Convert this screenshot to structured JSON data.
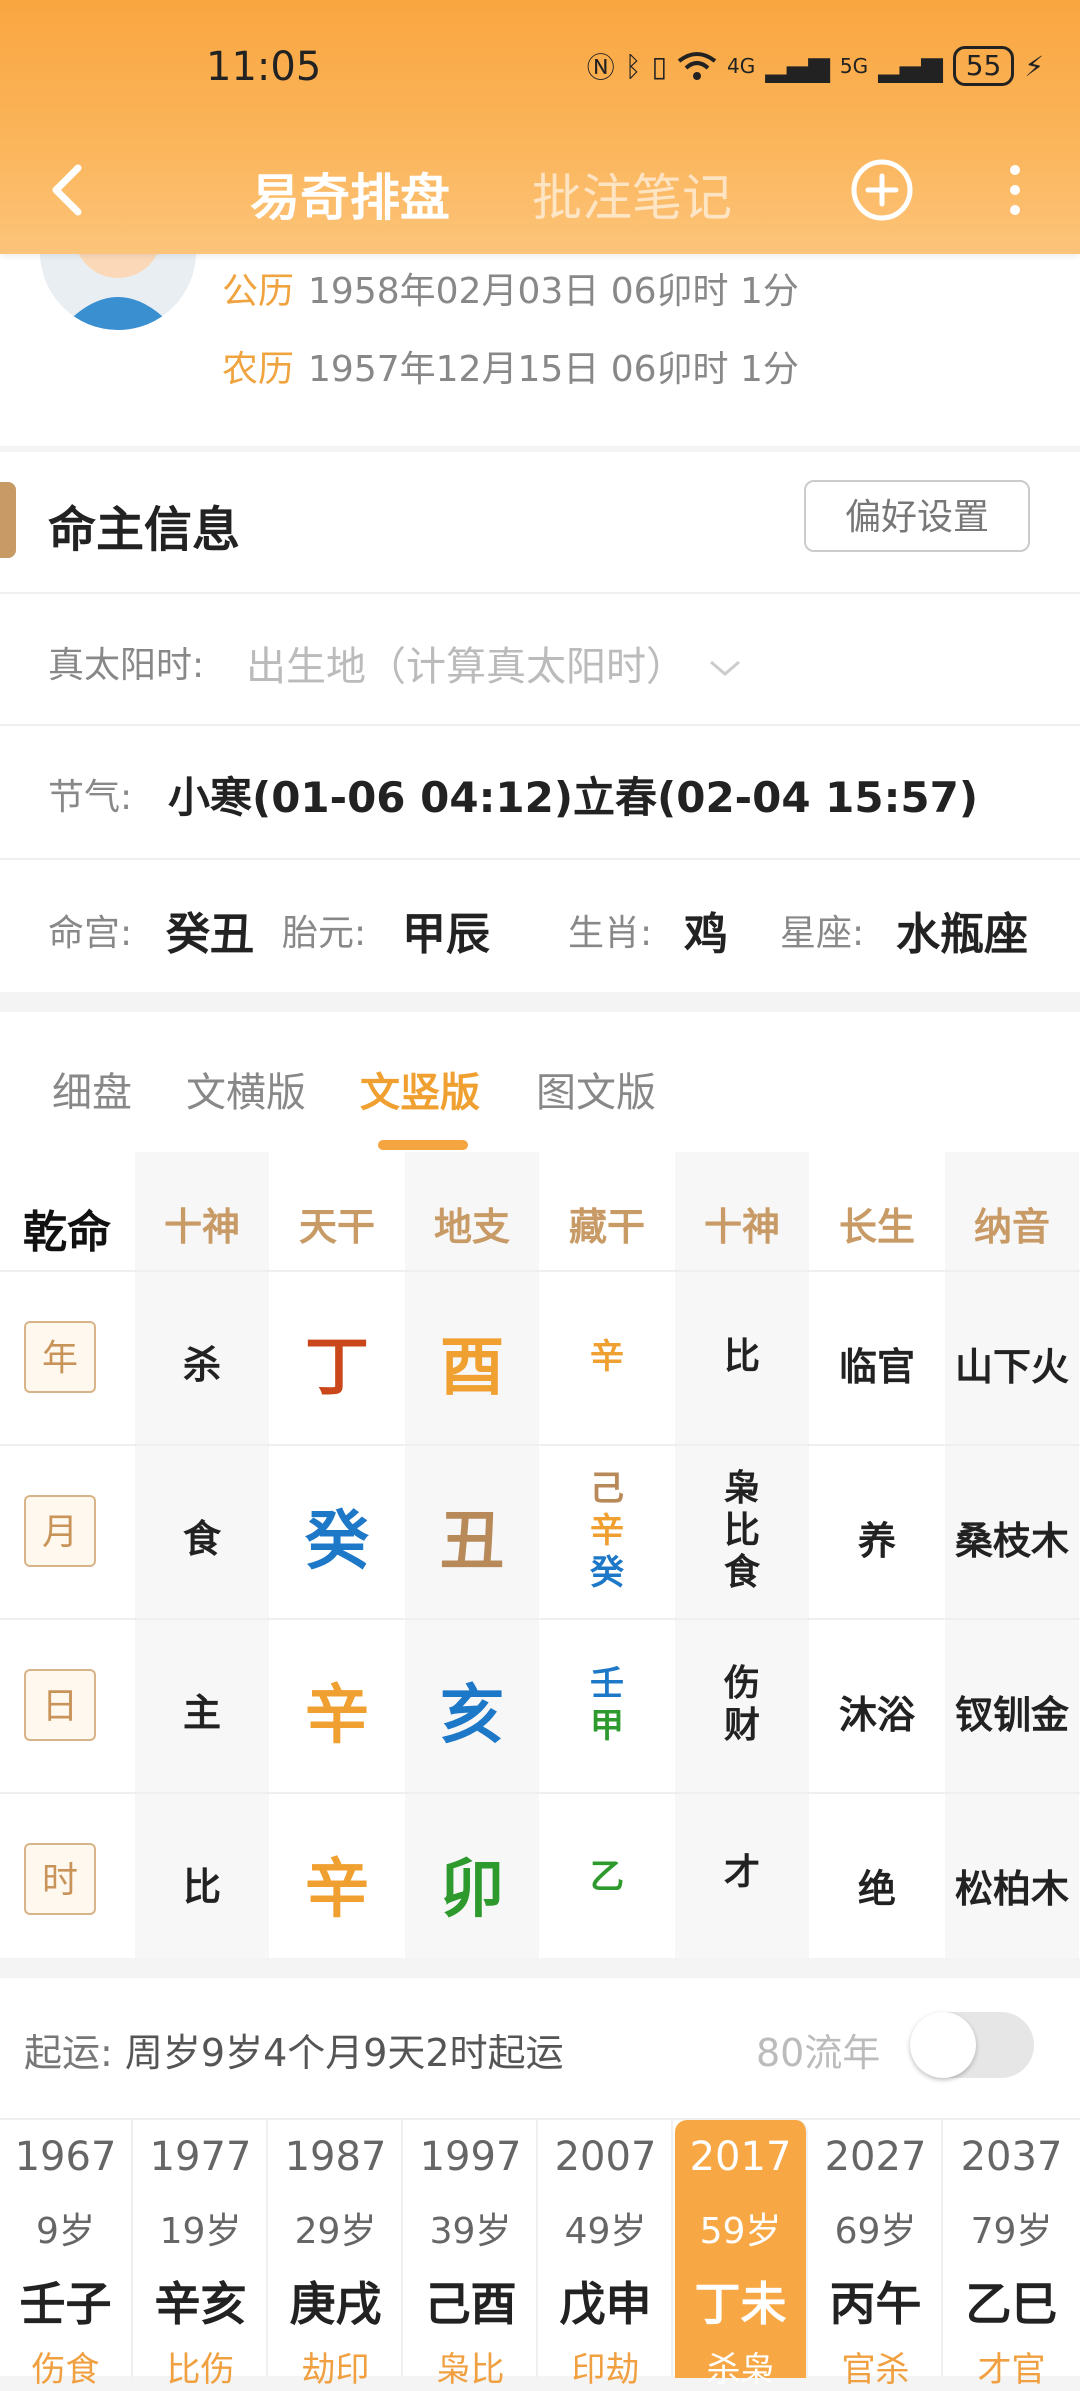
{
  "status": {
    "time": "11:05",
    "battery": "55",
    "signal_a": "4G",
    "signal_b": "5G"
  },
  "nav": {
    "tab_active": "易奇排盘",
    "tab_inactive": "批注笔记"
  },
  "profile": {
    "solar_label": "公历",
    "solar_value": "1958年02月03日 06卯时 1分",
    "lunar_label": "农历",
    "lunar_value": "1957年12月15日 06卯时 1分"
  },
  "info": {
    "title": "命主信息",
    "pref_button": "偏好设置",
    "solar_time_label": "真太阳时:",
    "solar_time_placeholder": "出生地（计算真太阳时）",
    "jieqi_label": "节气:",
    "jieqi_value": "小寒(01-06 04:12)立春(02-04 15:57)",
    "minggong_label": "命宫:",
    "minggong_value": "癸丑",
    "taiyuan_label": "胎元:",
    "taiyuan_value": "甲辰",
    "shengxiao_label": "生肖:",
    "shengxiao_value": "鸡",
    "xingzuo_label": "星座:",
    "xingzuo_value": "水瓶座"
  },
  "chart_tabs": [
    "细盘",
    "文横版",
    "文竖版",
    "图文版"
  ],
  "colors": {
    "accent": "#f5a540",
    "fire": "#c9471a",
    "earth": "#b88a5a",
    "water": "#1e78c8",
    "metal": "#f0a030",
    "wood": "#2e9a2e"
  },
  "grid": {
    "headers": [
      "乾命",
      "十神",
      "天干",
      "地支",
      "藏干",
      "十神",
      "长生",
      "纳音"
    ],
    "rows": [
      {
        "pillar": "年",
        "shishen": "杀",
        "gan": "丁",
        "zhi": "酉",
        "canggan": [
          "辛"
        ],
        "zhi_shishen": [
          "比"
        ],
        "changsheng": "临官",
        "nayin": "山下火"
      },
      {
        "pillar": "月",
        "shishen": "食",
        "gan": "癸",
        "zhi": "丑",
        "canggan": [
          "己",
          "辛",
          "癸"
        ],
        "zhi_shishen": [
          "枭",
          "比",
          "食"
        ],
        "changsheng": "养",
        "nayin": "桑枝木"
      },
      {
        "pillar": "日",
        "shishen": "主",
        "gan": "辛",
        "zhi": "亥",
        "canggan": [
          "壬",
          "甲"
        ],
        "zhi_shishen": [
          "伤",
          "财"
        ],
        "changsheng": "沐浴",
        "nayin": "钗钏金"
      },
      {
        "pillar": "时",
        "shishen": "比",
        "gan": "辛",
        "zhi": "卯",
        "canggan": [
          "乙"
        ],
        "zhi_shishen": [
          "才"
        ],
        "changsheng": "绝",
        "nayin": "松柏木"
      }
    ]
  },
  "dayun": {
    "qiyun_label": "起运:",
    "qiyun_value": "周岁9岁4个月9天2时起运",
    "liunian_label": "80流年",
    "items": [
      {
        "year": "1967",
        "age": "9岁",
        "ganzhi": "壬子",
        "shishen": "伤食"
      },
      {
        "year": "1977",
        "age": "19岁",
        "ganzhi": "辛亥",
        "shishen": "比伤"
      },
      {
        "year": "1987",
        "age": "29岁",
        "ganzhi": "庚戌",
        "shishen": "劫印"
      },
      {
        "year": "1997",
        "age": "39岁",
        "ganzhi": "己酉",
        "shishen": "枭比"
      },
      {
        "year": "2007",
        "age": "49岁",
        "ganzhi": "戊申",
        "shishen": "印劫"
      },
      {
        "year": "2017",
        "age": "59岁",
        "ganzhi": "丁未",
        "shishen": "杀枭"
      },
      {
        "year": "2027",
        "age": "69岁",
        "ganzhi": "丙午",
        "shishen": "官杀"
      },
      {
        "year": "2037",
        "age": "79岁",
        "ganzhi": "乙巳",
        "shishen": "才官"
      }
    ]
  }
}
